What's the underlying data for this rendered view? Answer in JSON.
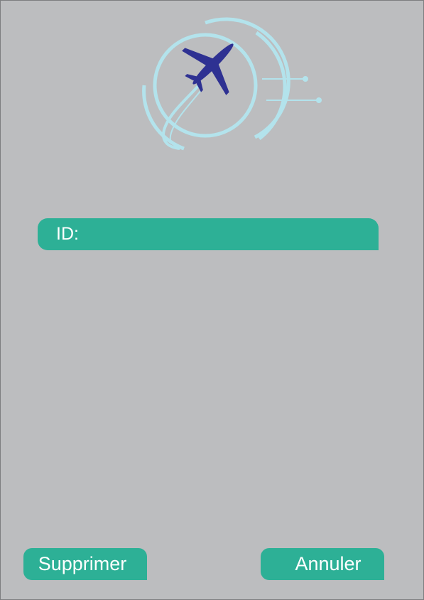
{
  "form": {
    "id_label": "ID:",
    "id_value": ""
  },
  "buttons": {
    "delete_label": "Supprimer",
    "cancel_label": "Annuler"
  },
  "logo": {
    "icon": "airplane-logo-icon",
    "plane_color": "#2e3192",
    "ring_color": "#b3e3ec"
  },
  "colors": {
    "background": "#bcbdbf",
    "accent": "#2db096",
    "text_on_accent": "#ffffff"
  }
}
